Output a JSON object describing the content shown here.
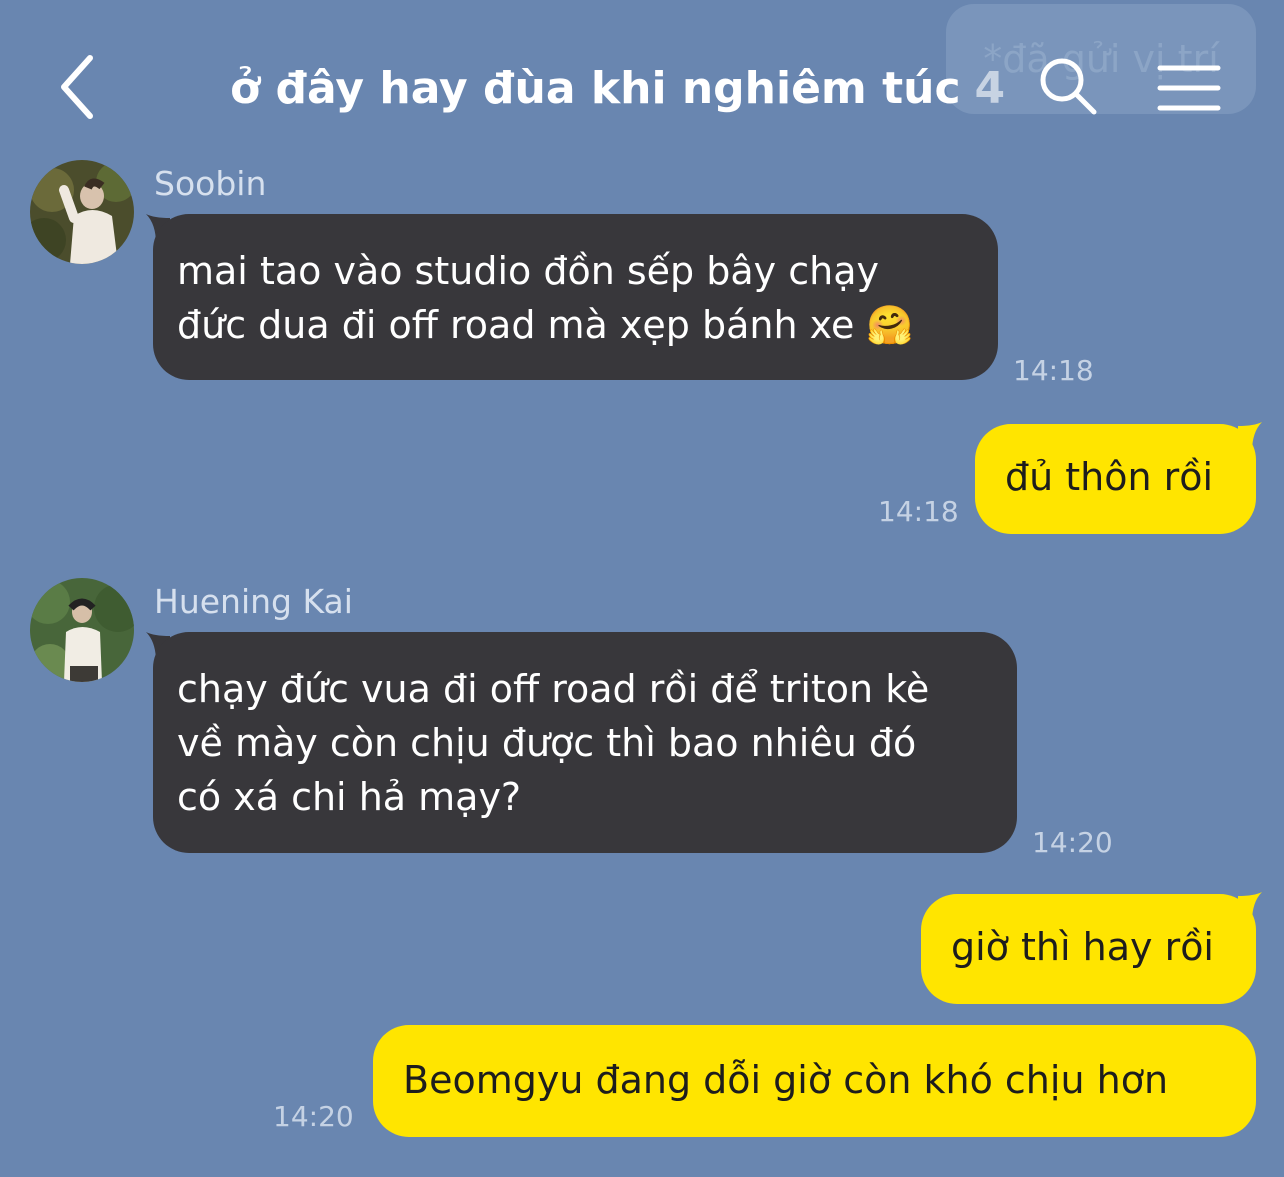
{
  "header": {
    "title": "ở đây hay đùa khi nghiêm túc",
    "member_count": "4",
    "back_icon": "chevron-left-icon",
    "search_icon": "search-icon",
    "menu_icon": "hamburger-menu-icon"
  },
  "ghost_bubble": {
    "text": "*đã gửi vị trí"
  },
  "messages": [
    {
      "sender": "Soobin",
      "lines": [
        "mai tao vào studio đồn sếp bây chạy",
        "đức dua đi off road mà xẹp bánh xe 🤗"
      ],
      "time": "14:18"
    },
    {
      "lines": [
        "đủ thôn rồi"
      ],
      "time": "14:18"
    },
    {
      "sender": "Huening Kai",
      "lines": [
        "chạy đức vua đi off road rồi để triton kè",
        "về mày còn chịu được thì bao nhiêu đó",
        "có xá chi hả mạy?"
      ],
      "time": "14:20"
    },
    {
      "lines": [
        "giờ thì hay rồi"
      ]
    },
    {
      "lines": [
        "Beomgyu đang dỗi giờ còn khó chịu hơn"
      ],
      "time": "14:20"
    }
  ],
  "colors": {
    "background": "#6986b0",
    "incoming_bubble": "#38373b",
    "outgoing_bubble": "#ffe500"
  }
}
